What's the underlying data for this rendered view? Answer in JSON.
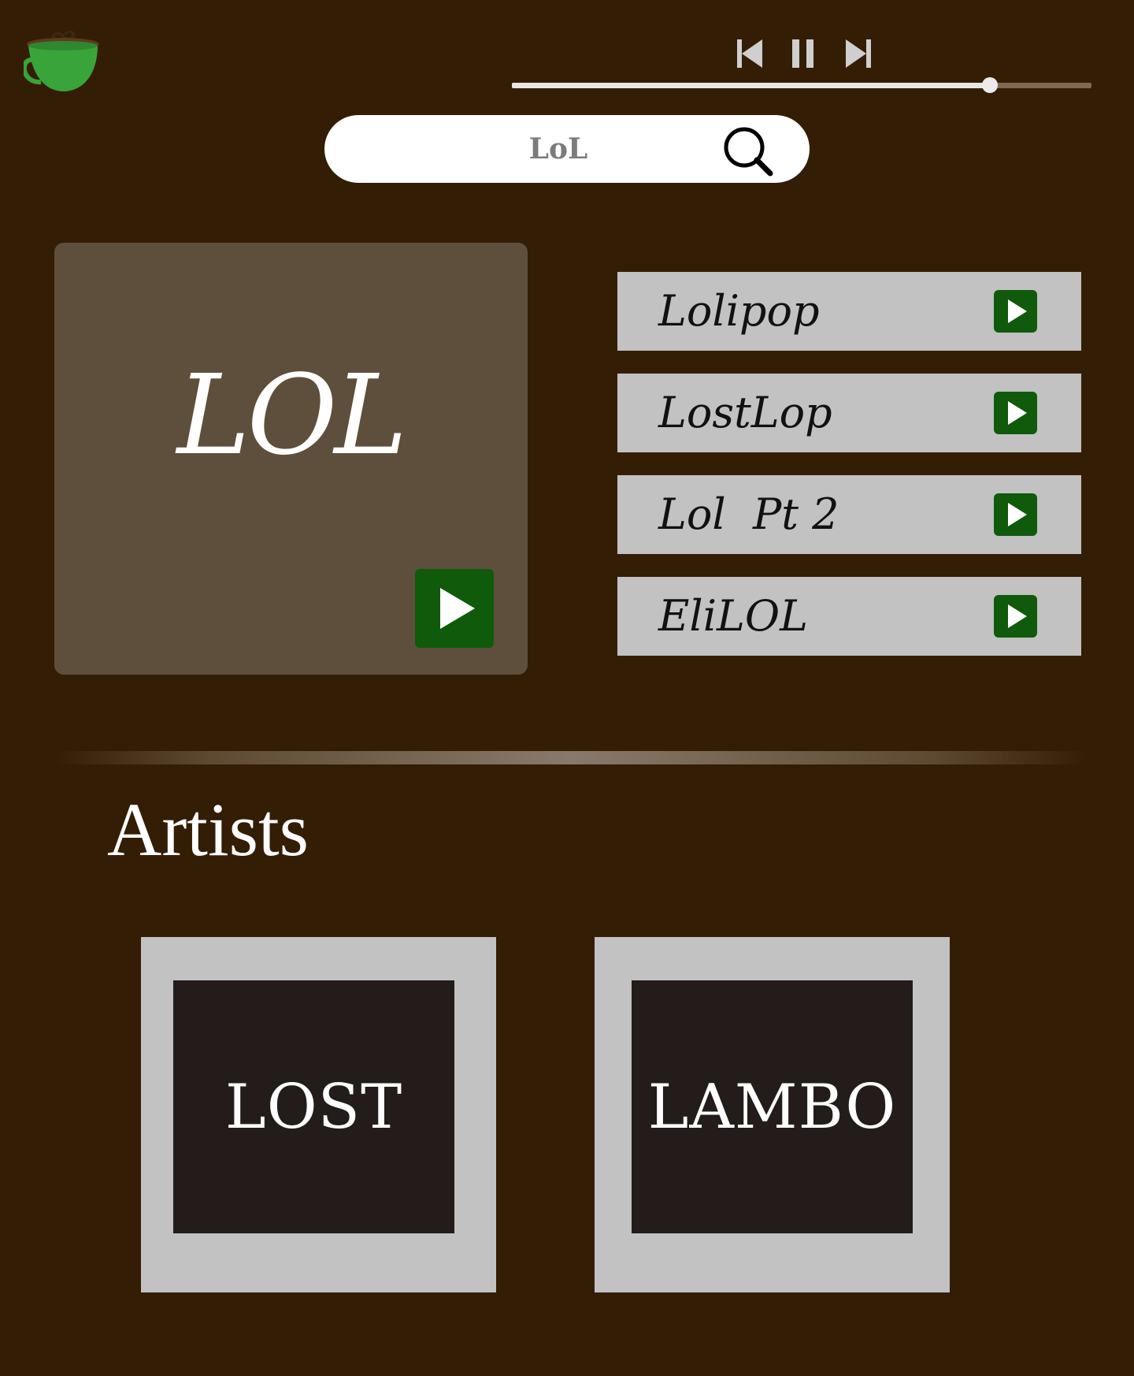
{
  "colors": {
    "background": "#341d05",
    "card": "#5e4f3c",
    "track_bg": "#c2c2c2",
    "play_green": "#0f5a0b",
    "logo_green": "#39a43a"
  },
  "logo": {
    "icon": "coffee-cup-icon"
  },
  "player": {
    "prev_icon": "skip-back-icon",
    "pause_icon": "pause-icon",
    "next_icon": "skip-forward-icon",
    "progress_fraction": 0.825
  },
  "search": {
    "value": "LoL",
    "icon": "search-icon"
  },
  "featured": {
    "title": "LOL",
    "play_icon": "play-icon"
  },
  "tracks": [
    {
      "title": "Lolipop"
    },
    {
      "title": "LostLop"
    },
    {
      "title": "Lol  Pt 2"
    },
    {
      "title": "EliLOL"
    }
  ],
  "artists": {
    "heading": "Artists",
    "items": [
      {
        "name": "LOST"
      },
      {
        "name": "LAMBO"
      }
    ]
  }
}
